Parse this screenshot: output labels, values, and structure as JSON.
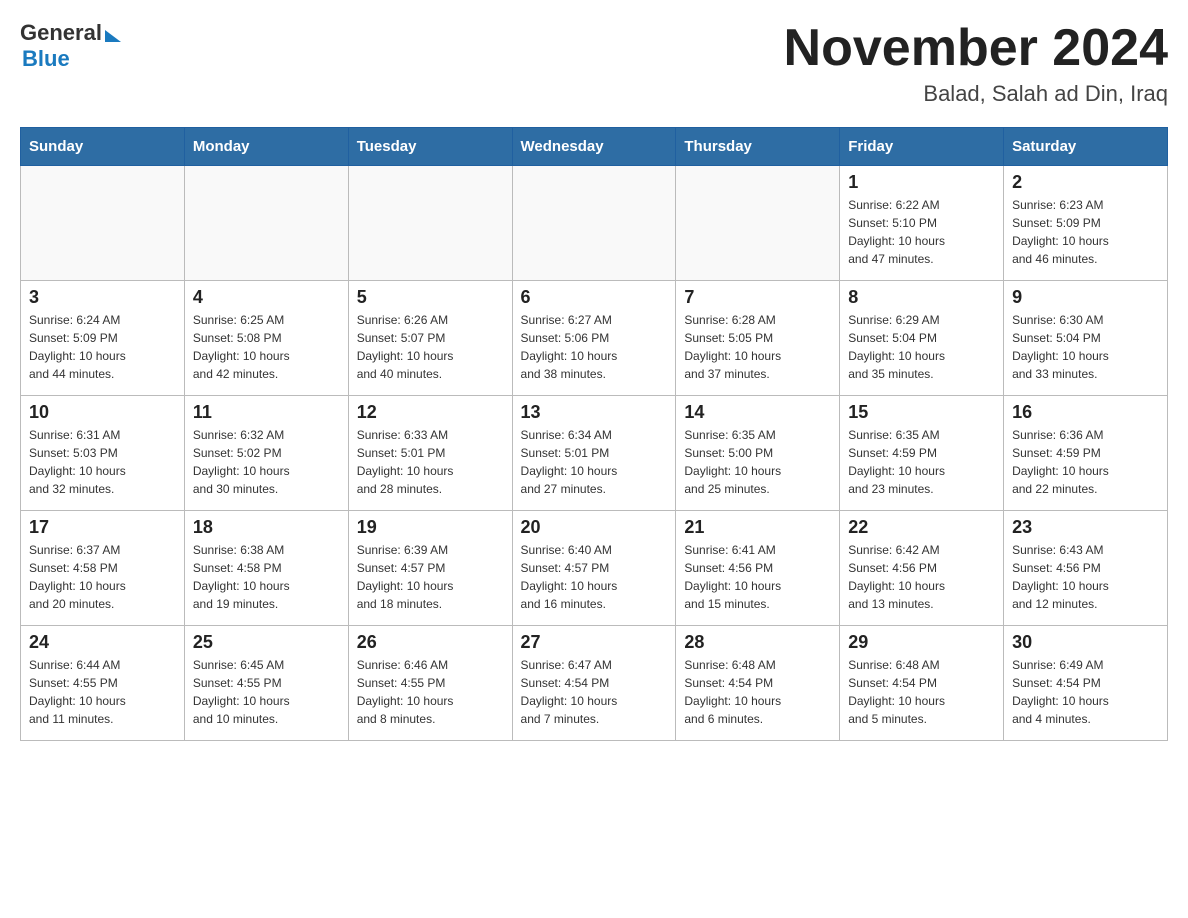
{
  "header": {
    "title": "November 2024",
    "subtitle": "Balad, Salah ad Din, Iraq",
    "logo_general": "General",
    "logo_blue": "Blue"
  },
  "days_of_week": [
    "Sunday",
    "Monday",
    "Tuesday",
    "Wednesday",
    "Thursday",
    "Friday",
    "Saturday"
  ],
  "weeks": [
    [
      {
        "day": "",
        "info": ""
      },
      {
        "day": "",
        "info": ""
      },
      {
        "day": "",
        "info": ""
      },
      {
        "day": "",
        "info": ""
      },
      {
        "day": "",
        "info": ""
      },
      {
        "day": "1",
        "info": "Sunrise: 6:22 AM\nSunset: 5:10 PM\nDaylight: 10 hours\nand 47 minutes."
      },
      {
        "day": "2",
        "info": "Sunrise: 6:23 AM\nSunset: 5:09 PM\nDaylight: 10 hours\nand 46 minutes."
      }
    ],
    [
      {
        "day": "3",
        "info": "Sunrise: 6:24 AM\nSunset: 5:09 PM\nDaylight: 10 hours\nand 44 minutes."
      },
      {
        "day": "4",
        "info": "Sunrise: 6:25 AM\nSunset: 5:08 PM\nDaylight: 10 hours\nand 42 minutes."
      },
      {
        "day": "5",
        "info": "Sunrise: 6:26 AM\nSunset: 5:07 PM\nDaylight: 10 hours\nand 40 minutes."
      },
      {
        "day": "6",
        "info": "Sunrise: 6:27 AM\nSunset: 5:06 PM\nDaylight: 10 hours\nand 38 minutes."
      },
      {
        "day": "7",
        "info": "Sunrise: 6:28 AM\nSunset: 5:05 PM\nDaylight: 10 hours\nand 37 minutes."
      },
      {
        "day": "8",
        "info": "Sunrise: 6:29 AM\nSunset: 5:04 PM\nDaylight: 10 hours\nand 35 minutes."
      },
      {
        "day": "9",
        "info": "Sunrise: 6:30 AM\nSunset: 5:04 PM\nDaylight: 10 hours\nand 33 minutes."
      }
    ],
    [
      {
        "day": "10",
        "info": "Sunrise: 6:31 AM\nSunset: 5:03 PM\nDaylight: 10 hours\nand 32 minutes."
      },
      {
        "day": "11",
        "info": "Sunrise: 6:32 AM\nSunset: 5:02 PM\nDaylight: 10 hours\nand 30 minutes."
      },
      {
        "day": "12",
        "info": "Sunrise: 6:33 AM\nSunset: 5:01 PM\nDaylight: 10 hours\nand 28 minutes."
      },
      {
        "day": "13",
        "info": "Sunrise: 6:34 AM\nSunset: 5:01 PM\nDaylight: 10 hours\nand 27 minutes."
      },
      {
        "day": "14",
        "info": "Sunrise: 6:35 AM\nSunset: 5:00 PM\nDaylight: 10 hours\nand 25 minutes."
      },
      {
        "day": "15",
        "info": "Sunrise: 6:35 AM\nSunset: 4:59 PM\nDaylight: 10 hours\nand 23 minutes."
      },
      {
        "day": "16",
        "info": "Sunrise: 6:36 AM\nSunset: 4:59 PM\nDaylight: 10 hours\nand 22 minutes."
      }
    ],
    [
      {
        "day": "17",
        "info": "Sunrise: 6:37 AM\nSunset: 4:58 PM\nDaylight: 10 hours\nand 20 minutes."
      },
      {
        "day": "18",
        "info": "Sunrise: 6:38 AM\nSunset: 4:58 PM\nDaylight: 10 hours\nand 19 minutes."
      },
      {
        "day": "19",
        "info": "Sunrise: 6:39 AM\nSunset: 4:57 PM\nDaylight: 10 hours\nand 18 minutes."
      },
      {
        "day": "20",
        "info": "Sunrise: 6:40 AM\nSunset: 4:57 PM\nDaylight: 10 hours\nand 16 minutes."
      },
      {
        "day": "21",
        "info": "Sunrise: 6:41 AM\nSunset: 4:56 PM\nDaylight: 10 hours\nand 15 minutes."
      },
      {
        "day": "22",
        "info": "Sunrise: 6:42 AM\nSunset: 4:56 PM\nDaylight: 10 hours\nand 13 minutes."
      },
      {
        "day": "23",
        "info": "Sunrise: 6:43 AM\nSunset: 4:56 PM\nDaylight: 10 hours\nand 12 minutes."
      }
    ],
    [
      {
        "day": "24",
        "info": "Sunrise: 6:44 AM\nSunset: 4:55 PM\nDaylight: 10 hours\nand 11 minutes."
      },
      {
        "day": "25",
        "info": "Sunrise: 6:45 AM\nSunset: 4:55 PM\nDaylight: 10 hours\nand 10 minutes."
      },
      {
        "day": "26",
        "info": "Sunrise: 6:46 AM\nSunset: 4:55 PM\nDaylight: 10 hours\nand 8 minutes."
      },
      {
        "day": "27",
        "info": "Sunrise: 6:47 AM\nSunset: 4:54 PM\nDaylight: 10 hours\nand 7 minutes."
      },
      {
        "day": "28",
        "info": "Sunrise: 6:48 AM\nSunset: 4:54 PM\nDaylight: 10 hours\nand 6 minutes."
      },
      {
        "day": "29",
        "info": "Sunrise: 6:48 AM\nSunset: 4:54 PM\nDaylight: 10 hours\nand 5 minutes."
      },
      {
        "day": "30",
        "info": "Sunrise: 6:49 AM\nSunset: 4:54 PM\nDaylight: 10 hours\nand 4 minutes."
      }
    ]
  ]
}
